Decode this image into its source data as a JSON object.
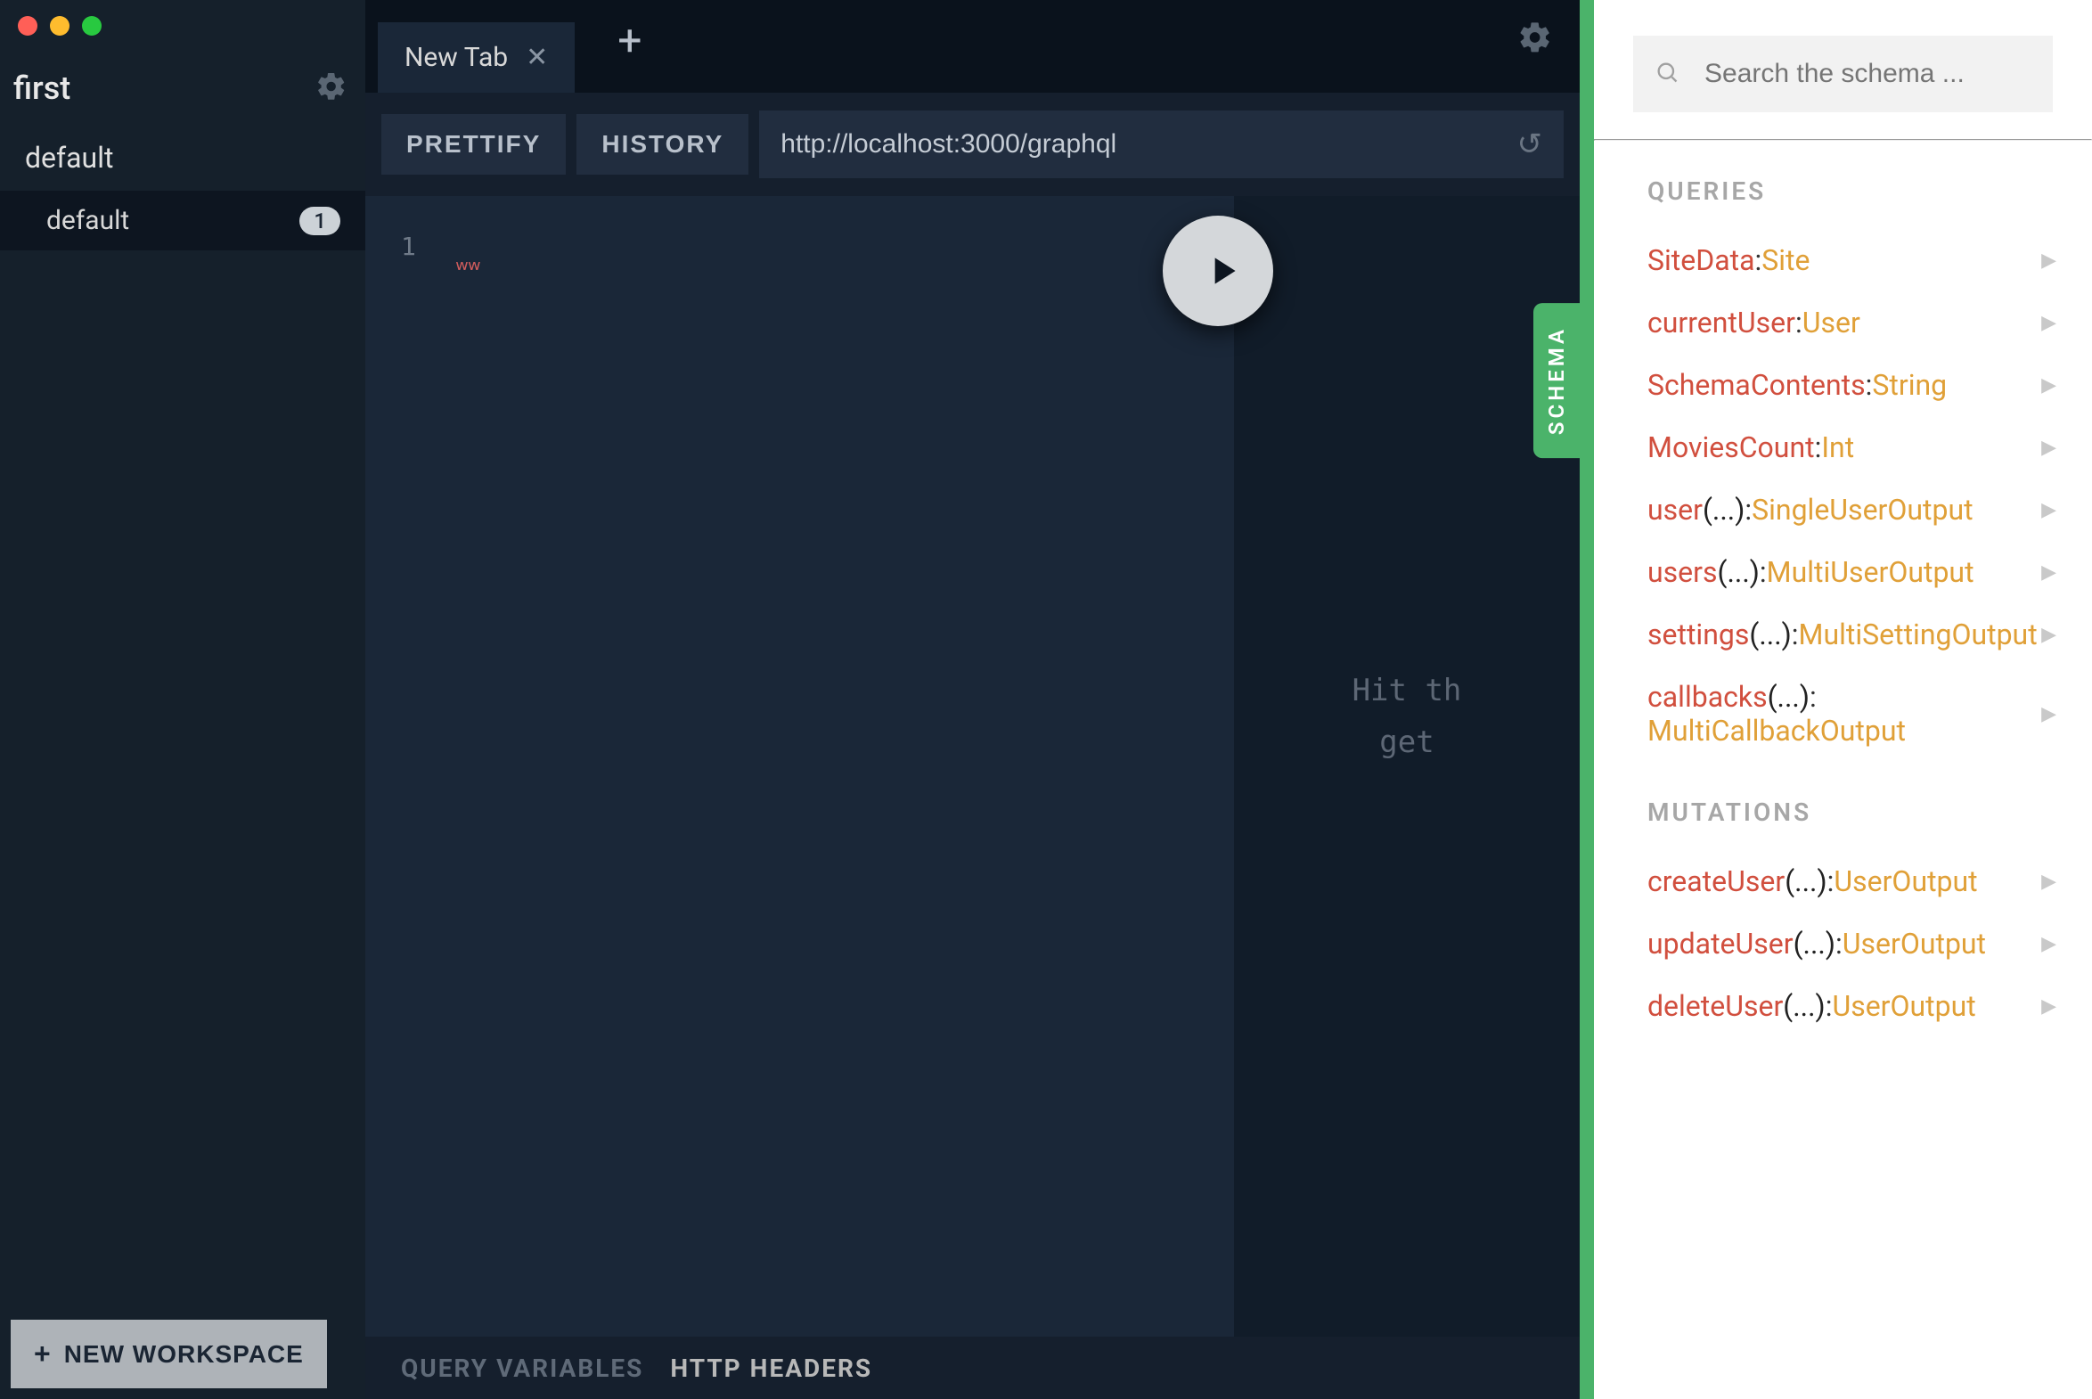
{
  "sidebar": {
    "workspace_title": "first",
    "project_label": "default",
    "session_label": "default",
    "session_count": "1",
    "new_workspace_label": "NEW WORKSPACE"
  },
  "tabbar": {
    "tab_label": "New Tab"
  },
  "toolbar": {
    "prettify": "PRETTIFY",
    "history": "HISTORY",
    "endpoint": "http://localhost:3000/graphql"
  },
  "editor": {
    "line_number": "1",
    "squiggle": "ʷʷ"
  },
  "result": {
    "hint": "Hit th\n get "
  },
  "schema_tab_label": "SCHEMA",
  "bottom_tabs": {
    "qv": "QUERY VARIABLES",
    "hh": "HTTP HEADERS"
  },
  "schema": {
    "search_placeholder": "Search the schema ...",
    "queries_title": "QUERIES",
    "mutations_title": "MUTATIONS",
    "queries": [
      {
        "name": "SiteData",
        "args": "",
        "type": "Site"
      },
      {
        "name": "currentUser",
        "args": "",
        "type": "User"
      },
      {
        "name": "SchemaContents",
        "args": "",
        "type": "String"
      },
      {
        "name": "MoviesCount",
        "args": "",
        "type": "Int"
      },
      {
        "name": "user",
        "args": "(...)",
        "type": "SingleUserOutput"
      },
      {
        "name": "users",
        "args": "(...)",
        "type": "MultiUserOutput"
      },
      {
        "name": "settings",
        "args": "(...)",
        "type": "MultiSettingOutput"
      },
      {
        "name": "callbacks",
        "args": "(...)",
        "type": "MultiCallbackOutput"
      }
    ],
    "mutations": [
      {
        "name": "createUser",
        "args": "(...)",
        "type": "UserOutput"
      },
      {
        "name": "updateUser",
        "args": "(...)",
        "type": "UserOutput"
      },
      {
        "name": "deleteUser",
        "args": "(...)",
        "type": "UserOutput"
      }
    ]
  }
}
